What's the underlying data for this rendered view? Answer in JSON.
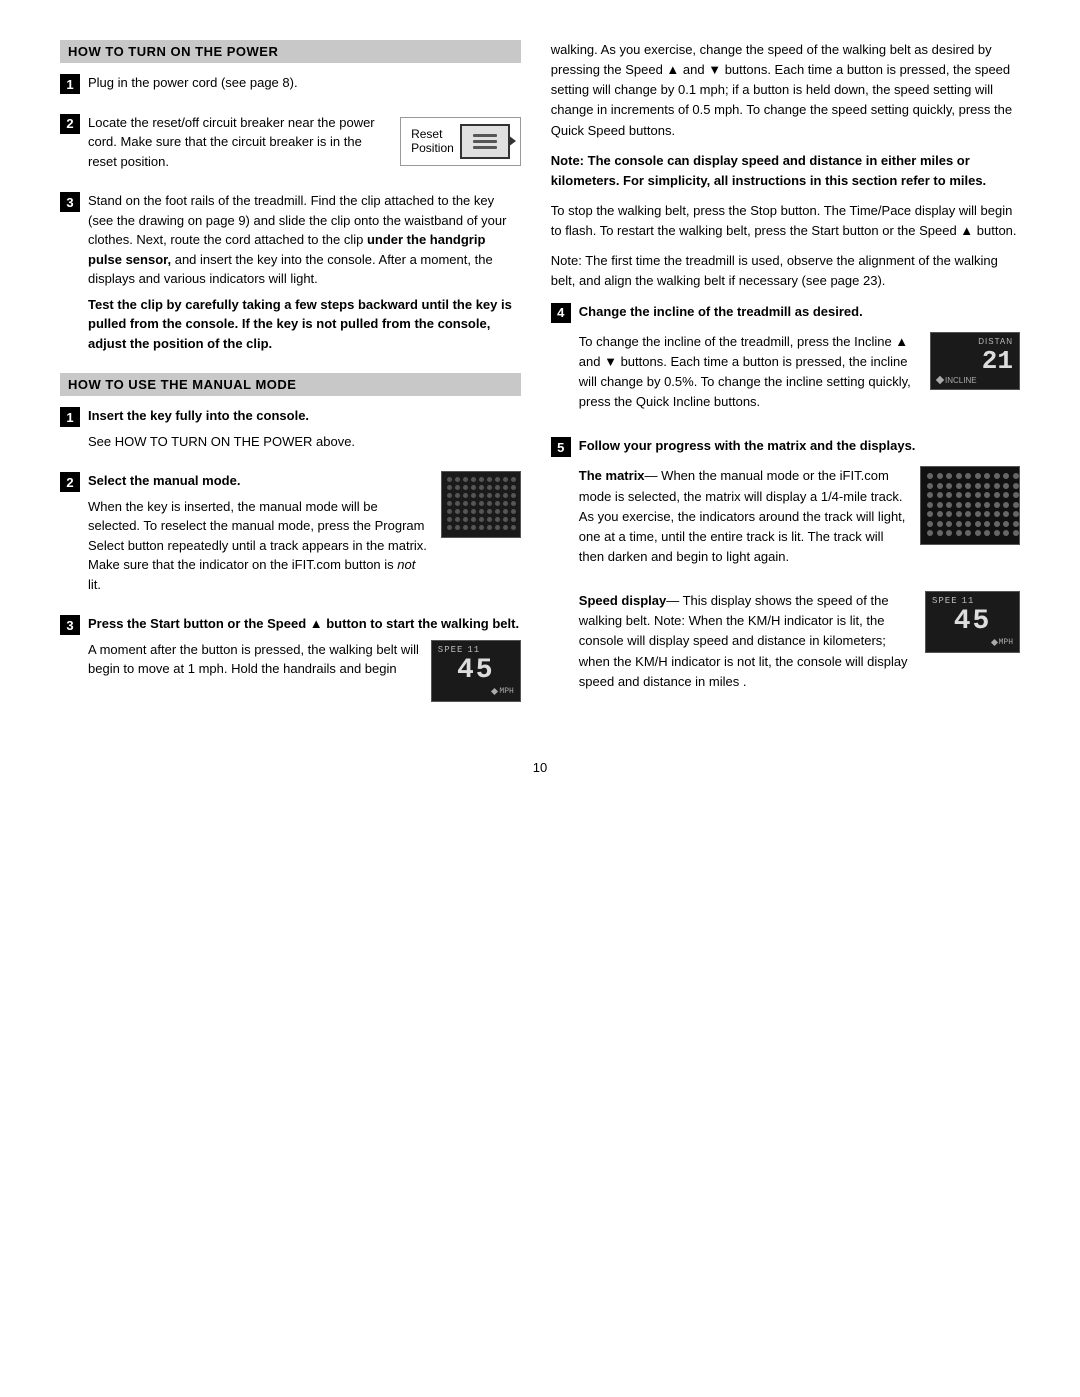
{
  "page": {
    "number": "10"
  },
  "left": {
    "section1": {
      "header": "HOW TO TURN ON THE POWER",
      "step1": {
        "number": "1",
        "text": "Plug in the power cord (see page 8)."
      },
      "step2": {
        "number": "2",
        "text_part1": "Locate the reset/off circuit breaker near the power cord. Make sure that the circuit breaker is in the reset position.",
        "diagram_label_line1": "Reset",
        "diagram_label_line2": "Position"
      },
      "step3": {
        "number": "3",
        "text_part1": "Stand on the foot rails of the treadmill. Find the clip attached to the key (see the drawing on page 9) and slide the clip onto the waistband of your clothes. Next, route the cord attached to the clip",
        "bold_text": "under the handgrip pulse sensor,",
        "text_part2": " and insert the key into the console. After a moment, the displays and various indicators will light.",
        "bold_text2": "Test the clip by carefully taking a few steps backward until the key is pulled from the console. If the key is not pulled from the console, adjust the position of the clip."
      }
    },
    "section2": {
      "header": "HOW TO USE THE MANUAL MODE",
      "step1": {
        "number": "1",
        "bold_text": "Insert the key fully into the console.",
        "text": "See HOW TO TURN ON THE POWER above."
      },
      "step2": {
        "number": "2",
        "bold_text": "Select the manual mode.",
        "text_part1": "When the key is inserted, the manual mode will be selected. To reselect the manual mode, press the Program Select button repeatedly until a track appears in the matrix. Make sure that the indicator on the iFIT.com button is",
        "italic_text": "not",
        "text_part2": " lit."
      },
      "step3": {
        "number": "3",
        "bold_text": "Press the Start button or the Speed ▲ button to start the walking belt.",
        "text_part1": "A moment after the button is pressed, the walking belt will begin to move at 1 mph. Hold the handrails and begin"
      }
    }
  },
  "right": {
    "intro_text": "walking. As you exercise, change the speed of the walking belt as desired by pressing the Speed ▲ and ▼ buttons. Each time a button is pressed, the speed setting will change by 0.1 mph; if a button is held down, the speed setting will change in increments of 0.5 mph. To change the speed setting quickly, press the Quick Speed buttons.",
    "bold_note": "Note: The console can display speed and distance in either miles or kilometers. For simplicity, all instructions in this section refer to miles.",
    "stop_text": "To stop the walking belt, press the Stop button. The Time/Pace display will begin to flash. To restart the walking belt, press the Start button or the Speed ▲ button.",
    "note_text": "Note: The first time the treadmill is used, observe the alignment of the walking belt, and align the walking belt if necessary (see page 23).",
    "step4": {
      "number": "4",
      "bold_text": "Change the incline of the treadmill as desired.",
      "text_part1": "To change the incline of the treadmill, press the Incline ▲ and ▼ buttons. Each time a button is pressed, the incline will change by 0.5%. To change the incline setting quickly, press the Quick Incline buttons.",
      "incline_display": {
        "top_label": "DISTAN",
        "number": "21",
        "bottom_label": "INCLINE"
      }
    },
    "step5": {
      "number": "5",
      "bold_text": "Follow your progress with the matrix and the displays.",
      "matrix_section": {
        "label": "The matrix",
        "em_dash": "—",
        "text": "When the manual mode or the iFIT.com mode is selected, the matrix will display a 1/4-mile track. As you exercise, the indicators around the track will light, one at a time, until the entire track is lit. The track will then darken and begin to light again."
      },
      "speed_section": {
        "label": "Speed display",
        "em_dash": "—",
        "text": "This display shows the speed of the walking belt. Note: When the KM/H indicator is lit, the console will display speed and distance in kilometers; when the KM/H indicator is not lit, the console will display speed and distance in miles .",
        "display": {
          "top": "SPEE 11",
          "number": "45",
          "bottom": "MPH"
        }
      }
    }
  },
  "speed_display": {
    "top": "SPEE 11",
    "number": "45",
    "bottom": "MPH"
  }
}
